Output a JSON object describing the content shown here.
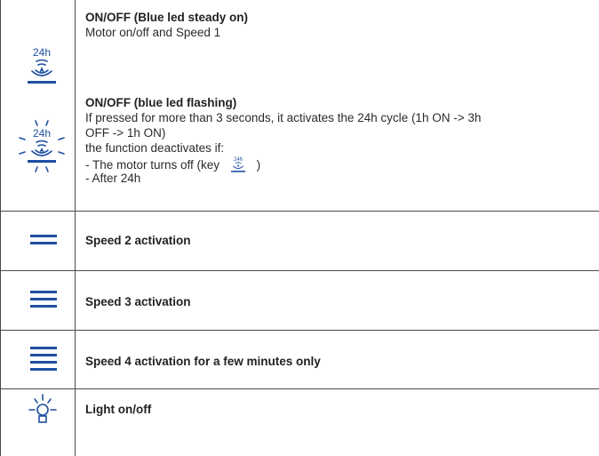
{
  "rows": [
    {
      "icon": "24h-fan-icon",
      "title": "ON/OFF (Blue led steady on)",
      "desc": "Motor on/off and Speed 1"
    },
    {
      "icon": "24h-fan-flashing-icon",
      "title": "ON/OFF (blue led flashing)",
      "line1": "If pressed for more than 3 seconds, it activates the 24h cycle (1h ON -> 3h",
      "line2": "OFF -> 1h ON)",
      "line3": "the function deactivates if:",
      "line4a": "- The motor turns off (key",
      "line4b": ")",
      "line5": "- After 24h"
    },
    {
      "icon": "speed-2-icon",
      "title": "Speed 2 activation"
    },
    {
      "icon": "speed-3-icon",
      "title": "Speed 3 activation"
    },
    {
      "icon": "speed-4-icon",
      "title": "Speed 4 activation for a few minutes only"
    },
    {
      "icon": "light-bulb-icon",
      "title": "Light on/off"
    }
  ],
  "icon_text": "24h",
  "colors": {
    "accent": "#1e4fa0",
    "rule": "#4a4a4a",
    "text": "#2b2b2b"
  }
}
